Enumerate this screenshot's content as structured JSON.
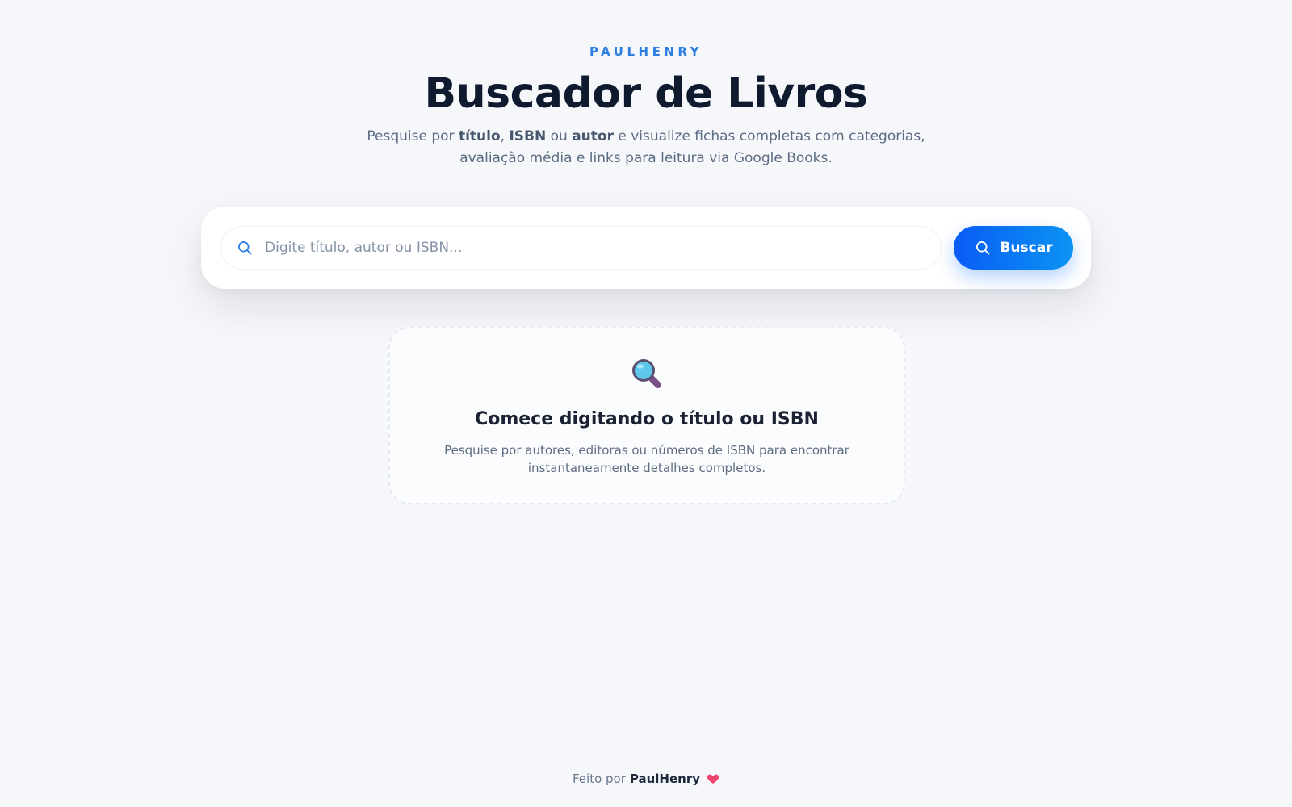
{
  "header": {
    "brand": "PAULHENRY",
    "title": "Buscador de Livros",
    "subtitle": {
      "part1": "Pesquise por ",
      "bold1": "título",
      "part2": ", ",
      "bold2": "ISBN",
      "part3": " ou ",
      "bold3": "autor",
      "part4": " e visualize fichas completas com categorias, avaliação média e links para leitura via Google Books."
    }
  },
  "search": {
    "placeholder": "Digite título, autor ou ISBN...",
    "value": "",
    "button_label": "Buscar",
    "icon": "search-icon"
  },
  "empty_state": {
    "icon": "magnifying-glass-icon",
    "title": "Comece digitando o título ou ISBN",
    "description": "Pesquise por autores, editoras ou números de ISBN para encontrar instantaneamente detalhes completos."
  },
  "footer": {
    "prefix": "Feito por",
    "author": "PaulHenry",
    "icon": "heart-icon"
  },
  "colors": {
    "accent": "#2f7fe0",
    "button_start": "#0a5cf6",
    "button_end": "#0b93f2",
    "heart": "#f0436e"
  }
}
